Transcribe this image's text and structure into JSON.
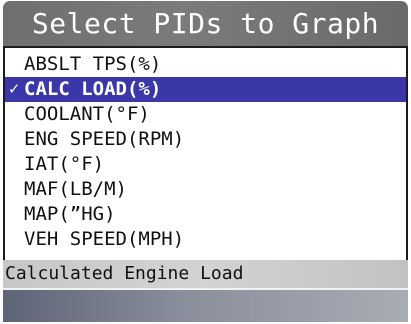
{
  "title": "Select PIDs to Graph",
  "pid_list": {
    "items": [
      {
        "label": "ABSLT TPS(%)",
        "checked": false,
        "highlighted": false
      },
      {
        "label": "CALC LOAD(%)",
        "checked": true,
        "highlighted": true
      },
      {
        "label": "COOLANT(°F)",
        "checked": false,
        "highlighted": false
      },
      {
        "label": "ENG SPEED(RPM)",
        "checked": false,
        "highlighted": false
      },
      {
        "label": "IAT(°F)",
        "checked": false,
        "highlighted": false
      },
      {
        "label": "MAF(LB/M)",
        "checked": false,
        "highlighted": false
      },
      {
        "label": "MAP(”HG)",
        "checked": false,
        "highlighted": false
      },
      {
        "label": "VEH SPEED(MPH)",
        "checked": false,
        "highlighted": false
      }
    ],
    "check_mark": "✓"
  },
  "status": "Calculated Engine Load",
  "colors": {
    "title_bar": "#737373",
    "highlight": "#3a37a8",
    "status_bar": "#cdcdcd",
    "bottom_bar_start": "#5d6476",
    "bottom_bar_end": "#a8acb4"
  },
  "icons": {
    "checkbox": "check-icon"
  }
}
